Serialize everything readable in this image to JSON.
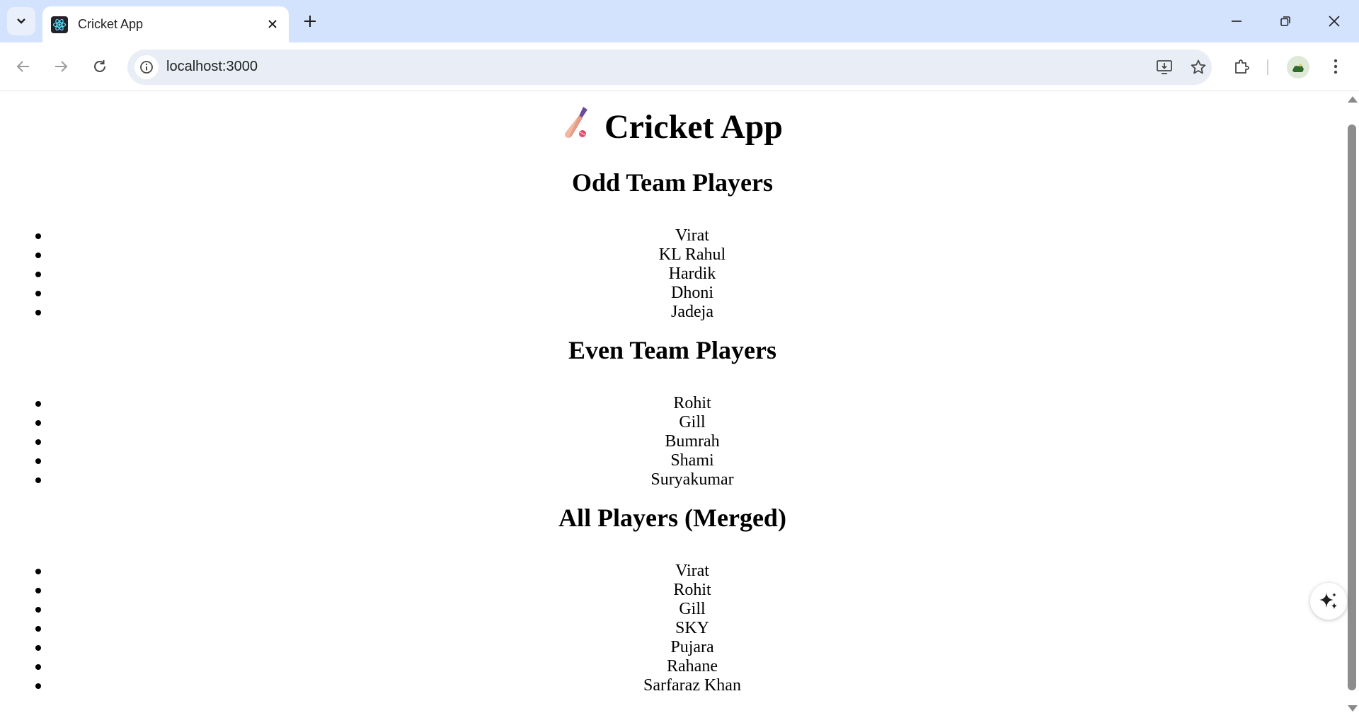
{
  "browser": {
    "tab_title": "Cricket App",
    "url": "localhost:3000",
    "icons": {
      "tab_search": "chevron-down-icon",
      "favicon": "react-icon",
      "tab_close": "close-icon",
      "new_tab": "plus-icon",
      "back": "back-arrow-icon",
      "forward": "forward-arrow-icon",
      "reload": "reload-icon",
      "site_info": "info-icon",
      "install": "install-app-icon",
      "bookmark": "star-icon",
      "extensions": "puzzle-icon",
      "profile": "avatar",
      "menu": "kebab-menu-icon"
    }
  },
  "page": {
    "title_emoji": "bat-icon",
    "title": "Cricket App",
    "odd_heading": "Odd Team Players",
    "odd_players": [
      "Virat",
      "KL Rahul",
      "Hardik",
      "Dhoni",
      "Jadeja"
    ],
    "even_heading": "Even Team Players",
    "even_players": [
      "Rohit",
      "Gill",
      "Bumrah",
      "Shami",
      "Suryakumar"
    ],
    "merged_heading": "All Players (Merged)",
    "merged_players": [
      "Virat",
      "Rohit",
      "Gill",
      "SKY",
      "Pujara",
      "Rahane",
      "Sarfaraz Khan"
    ]
  },
  "colors": {
    "tabbar_bg": "#d3e3fd",
    "omnibox_bg": "#e9eef6",
    "text": "#000000"
  }
}
